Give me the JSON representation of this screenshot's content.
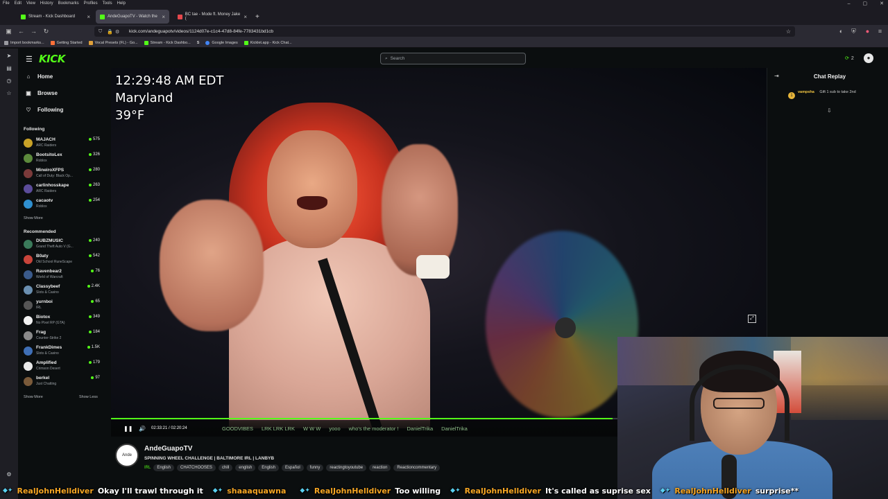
{
  "menubar": [
    "File",
    "Edit",
    "View",
    "History",
    "Bookmarks",
    "Profiles",
    "Tools",
    "Help"
  ],
  "window_controls": [
    "–",
    "▢",
    "✕"
  ],
  "tabs": [
    {
      "label": "Stream - Kick Dashboard",
      "color": "#53fc18",
      "active": false
    },
    {
      "label": "AndeGuapoTV - Watch the",
      "color": "#53fc18",
      "active": true
    },
    {
      "label": "BC tae - Mode ft. Money Jake (",
      "color": "#e5484d",
      "active": false
    }
  ],
  "new_tab": "+",
  "url": "kick.com/andeguapotv/videos/1124d07e-c1c4-47d8-84fe-7783431bd1cb",
  "bookmarks": [
    {
      "label": "Import bookmarks...",
      "color": "#9a9aa0"
    },
    {
      "label": "Getting Started",
      "color": "#ff7139"
    },
    {
      "label": "Vocal Presets (FL) - Go...",
      "color": "#e0a03a"
    },
    {
      "label": "Stream - Kick Dashbo...",
      "color": "#53fc18"
    },
    {
      "label": "S",
      "color": "#ffffff"
    },
    {
      "label": "Google Images",
      "color": "#4285f4"
    },
    {
      "label": "Kicklet.app - Kick Chat...",
      "color": "#53fc18"
    }
  ],
  "kick": {
    "logo": "KICK",
    "search_placeholder": "Search",
    "viewer_count": "2"
  },
  "nav": [
    {
      "label": "Home",
      "icon": "home-icon"
    },
    {
      "label": "Browse",
      "icon": "browse-icon"
    },
    {
      "label": "Following",
      "icon": "heart-icon"
    }
  ],
  "following_title": "Following",
  "following": [
    {
      "name": "MAJACH",
      "game": "ARC Raiders",
      "viewers": "575",
      "color": "#c9a227"
    },
    {
      "name": "BootsitoLex",
      "game": "Roblox",
      "viewers": "326",
      "color": "#5c8a3c"
    },
    {
      "name": "MineiroXFPS",
      "game": "Call of Duty: Black Op...",
      "viewers": "280",
      "color": "#7a3a3a"
    },
    {
      "name": "carlinhosskape",
      "game": "ARC Raiders",
      "viewers": "263",
      "color": "#5b4c9a"
    },
    {
      "name": "cacaotv",
      "game": "Roblox",
      "viewers": "254",
      "color": "#2f8fcf"
    }
  ],
  "following_show_more": "Show More",
  "recommended_title": "Recommended",
  "recommended": [
    {
      "name": "DUBZMUSIC",
      "game": "Grand Theft Auto V (G...",
      "viewers": "240",
      "color": "#3a7a5a"
    },
    {
      "name": "B0aty",
      "game": "Old School RuneScape",
      "viewers": "542",
      "color": "#c8443a"
    },
    {
      "name": "Ravenbear2",
      "game": "World of Warcraft",
      "viewers": "76",
      "color": "#3a5a8a"
    },
    {
      "name": "Classybeef",
      "game": "Slots & Casino",
      "viewers": "2.4K",
      "color": "#6a8fb0"
    },
    {
      "name": "yurnboi",
      "game": "IRL",
      "viewers": "65",
      "color": "#555555"
    },
    {
      "name": "Biotox",
      "game": "No Pixel RP (GTA)",
      "viewers": "349",
      "color": "#f2f2f2"
    },
    {
      "name": "Frag",
      "game": "Counter-Strike 2",
      "viewers": "184",
      "color": "#8a8a8a"
    },
    {
      "name": "FrankDimes",
      "game": "Slots & Casino",
      "viewers": "1.5K",
      "color": "#3f6fb6"
    },
    {
      "name": "Amplified",
      "game": "Crimson Desert",
      "viewers": "179",
      "color": "#e9e9e9"
    },
    {
      "name": "berkel",
      "game": "Just Chatting",
      "viewers": "97",
      "color": "#7a5a3a"
    }
  ],
  "recommended_show_more": "Show More",
  "recommended_show_less": "Show Less",
  "video": {
    "overlay_time": "12:29:48 AM EDT",
    "overlay_location": "Maryland",
    "overlay_temp": "39°F",
    "progress": 0.99,
    "time_display": "02:33:21 / 02:20:24",
    "ticker": [
      "GOODVIBES",
      "LRK LRK LRK",
      "W W W",
      "yooo",
      "who's the moderator !",
      "DanielTrika",
      "DanielTrika"
    ]
  },
  "stream": {
    "avatar_text": "Ande",
    "streamer": "AndeGuapoTV",
    "title": "SPINNING WHEEL CHALLENGE | BALTIMORE IRL | LANBYB",
    "category": "IRL",
    "tags": [
      "English",
      "CHATCHOOSES",
      "chill",
      "english",
      "English",
      "Español",
      "funny",
      "reactingtoyoutube",
      "reaction",
      "Reactioncommentary"
    ]
  },
  "chat": {
    "title": "Chat Replay",
    "message_user": "vampsha",
    "message_text": "Gift 1 sub to take 2nd",
    "badge": "1"
  },
  "bottom_ticker": [
    {
      "user": "RealJohnHelldiver",
      "msg": "Okay I'll trawl through it"
    },
    {
      "user": "shaaaquawna",
      "msg": ""
    },
    {
      "user": "RealJohnHelldiver",
      "msg": "Too willing"
    },
    {
      "user": "RealJohnHelldiver",
      "msg": "It's called as suprise sex"
    },
    {
      "user": "RealJohnHelldiver",
      "msg": "surprise**"
    }
  ]
}
